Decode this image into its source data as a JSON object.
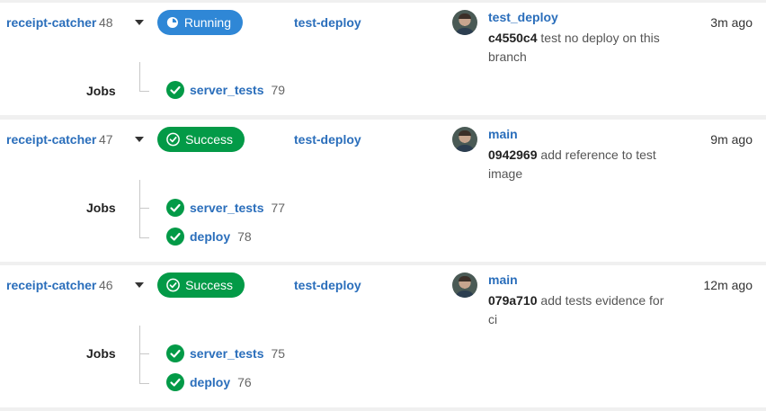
{
  "builds": [
    {
      "repo": "receipt-catcher",
      "number": "48",
      "status": "Running",
      "branch": "test-deploy",
      "commit_branch": "test_deploy",
      "sha": "c4550c4",
      "message": "test no deploy on this branch",
      "time": "3m ago",
      "jobs_label": "Jobs",
      "jobs": [
        {
          "name": "server_tests",
          "number": "79",
          "status": "success"
        }
      ]
    },
    {
      "repo": "receipt-catcher",
      "number": "47",
      "status": "Success",
      "branch": "test-deploy",
      "commit_branch": "main",
      "sha": "0942969",
      "message": "add reference to test image",
      "time": "9m ago",
      "jobs_label": "Jobs",
      "jobs": [
        {
          "name": "server_tests",
          "number": "77",
          "status": "success"
        },
        {
          "name": "deploy",
          "number": "78",
          "status": "success"
        }
      ]
    },
    {
      "repo": "receipt-catcher",
      "number": "46",
      "status": "Success",
      "branch": "test-deploy",
      "commit_branch": "main",
      "sha": "079a710",
      "message": "add tests evidence for ci",
      "time": "12m ago",
      "jobs_label": "Jobs",
      "jobs": [
        {
          "name": "server_tests",
          "number": "75",
          "status": "success"
        },
        {
          "name": "deploy",
          "number": "76",
          "status": "success"
        }
      ]
    }
  ],
  "colors": {
    "running": "#2f87d6",
    "success": "#039a47",
    "link": "#2a6ebb"
  },
  "icons": {
    "running": "running-spinner-icon",
    "success": "check-circle-icon",
    "toggle": "caret-down-icon"
  }
}
